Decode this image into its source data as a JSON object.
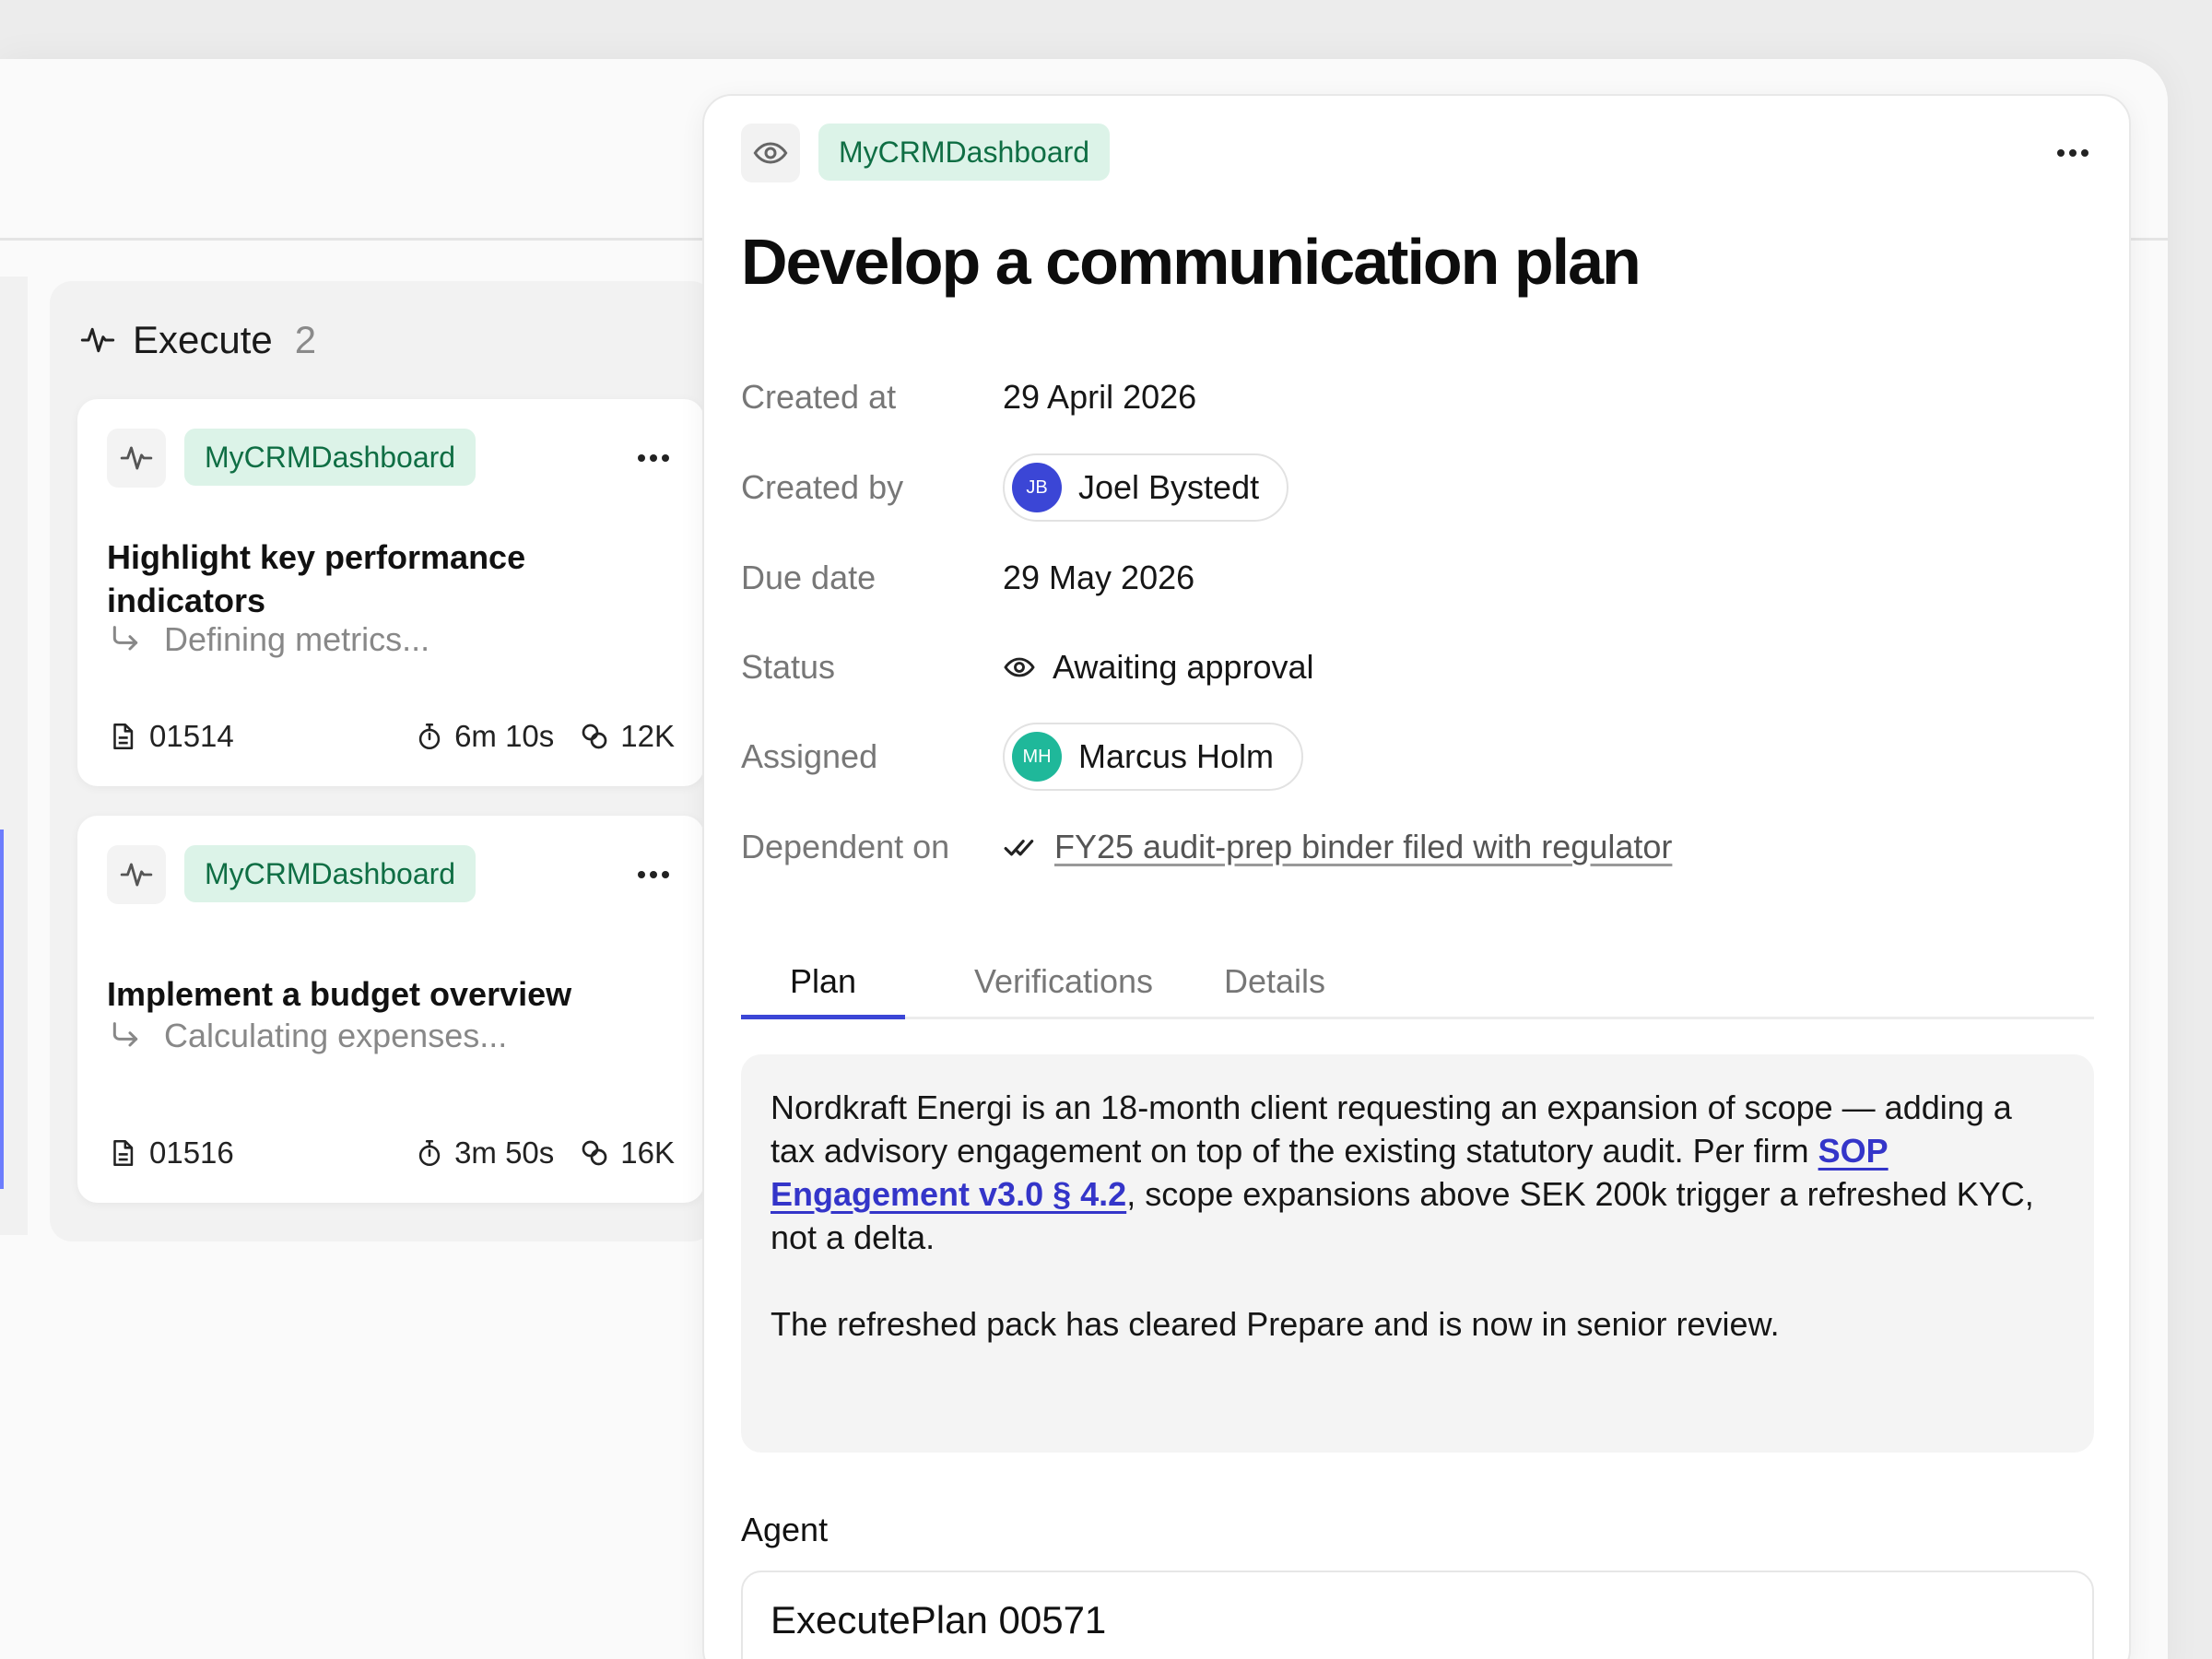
{
  "column": {
    "title": "Execute",
    "count": "2",
    "cards": [
      {
        "tag": "MyCRMDashboard",
        "title": "Highlight key performance indicators",
        "subtitle": "Defining metrics...",
        "id": "01514",
        "duration": "6m 10s",
        "tokens": "12K"
      },
      {
        "tag": "MyCRMDashboard",
        "title": "Implement a budget overview",
        "subtitle": "Calculating expenses...",
        "id": "01516",
        "duration": "3m 50s",
        "tokens": "16K"
      }
    ]
  },
  "panel": {
    "tag": "MyCRMDashboard",
    "title": "Develop a communication plan",
    "props": {
      "created_at": {
        "label": "Created at",
        "value": "29 April 2026"
      },
      "created_by": {
        "label": "Created by",
        "value": "Joel Bystedt",
        "initials": "JB",
        "avatar_color": "#3b46d6"
      },
      "due_date": {
        "label": "Due date",
        "value": "29 May 2026"
      },
      "status": {
        "label": "Status",
        "value": "Awaiting approval"
      },
      "assigned": {
        "label": "Assigned",
        "value": "Marcus Holm",
        "initials": "MH",
        "avatar_color": "#1fb89a"
      },
      "dependent_on": {
        "label": "Dependent on",
        "value": "FY25 audit-prep binder filed with regulator"
      }
    },
    "tabs": [
      "Plan",
      "Verifications",
      "Details"
    ],
    "active_tab": "Plan",
    "plan": {
      "p1_before": "Nordkraft Energi is an 18-month client requesting an expansion of scope — adding a tax advisory engagement on top of the existing statutory audit. Per firm ",
      "p1_link": "SOP Engagement v3.0 § 4.2",
      "p1_after": ", scope expansions above SEK 200k trigger a refreshed KYC, not a delta.",
      "p2": "The refreshed pack has cleared Prepare and is now in senior review."
    },
    "agent_label": "Agent",
    "agent_name": "ExecutePlan 00571"
  },
  "colors": {
    "tag_bg": "#dcf3e8",
    "tag_text": "#0f6e44",
    "accent": "#3b46d6",
    "link": "#3435c9"
  }
}
